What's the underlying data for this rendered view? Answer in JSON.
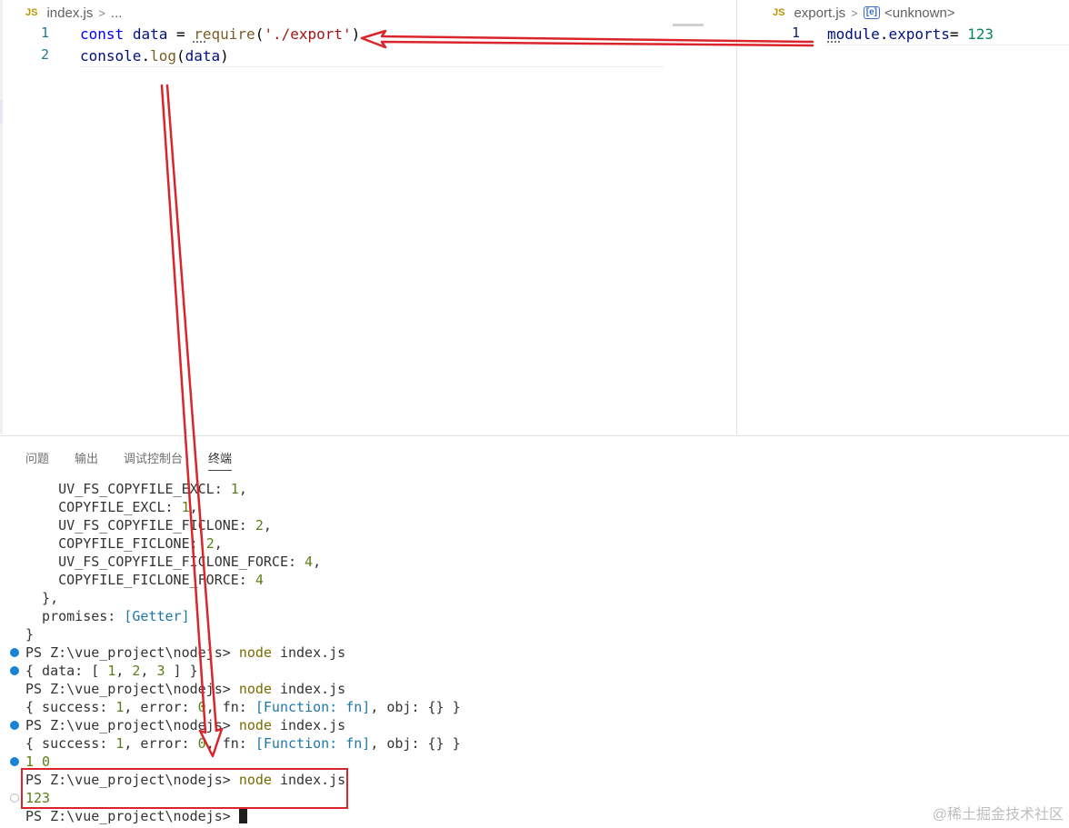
{
  "editor_left": {
    "breadcrumb": {
      "file_icon": "JS",
      "file": "index.js",
      "rest": "..."
    },
    "lines": [
      {
        "n": "1",
        "tokens": [
          {
            "t": "const",
            "c": "kw"
          },
          {
            "t": " ",
            "c": "plain"
          },
          {
            "t": "data",
            "c": "var"
          },
          {
            "t": " = ",
            "c": "plain"
          },
          {
            "t": "require",
            "c": "fn"
          },
          {
            "t": "(",
            "c": "plain"
          },
          {
            "t": "'./export'",
            "c": "str"
          },
          {
            "t": ")",
            "c": "plain"
          }
        ]
      },
      {
        "n": "2",
        "tokens": [
          {
            "t": "console",
            "c": "var"
          },
          {
            "t": ".",
            "c": "plain"
          },
          {
            "t": "log",
            "c": "fn"
          },
          {
            "t": "(",
            "c": "plain"
          },
          {
            "t": "data",
            "c": "var"
          },
          {
            "t": ")",
            "c": "plain"
          }
        ]
      }
    ]
  },
  "editor_right": {
    "breadcrumb": {
      "file_icon": "JS",
      "file": "export.js",
      "symbol_icon": "[e]",
      "symbol": "<unknown>"
    },
    "lines": [
      {
        "n": "1",
        "tokens": [
          {
            "t": "module",
            "c": "var"
          },
          {
            "t": ".",
            "c": "plain"
          },
          {
            "t": "exports",
            "c": "var"
          },
          {
            "t": "= ",
            "c": "plain"
          },
          {
            "t": "123",
            "c": "num"
          }
        ]
      }
    ]
  },
  "panel": {
    "tabs": [
      {
        "label": "问题",
        "active": false
      },
      {
        "label": "输出",
        "active": false
      },
      {
        "label": "调试控制台",
        "active": false
      },
      {
        "label": "终端",
        "active": true
      }
    ],
    "terminal_lines": [
      {
        "dot": "",
        "segs": [
          {
            "t": "    UV_FS_COPYFILE_EXCL: "
          },
          {
            "t": "1",
            "c": "t-num"
          },
          {
            "t": ","
          }
        ]
      },
      {
        "dot": "",
        "segs": [
          {
            "t": "    COPYFILE_EXCL: "
          },
          {
            "t": "1",
            "c": "t-num"
          },
          {
            "t": ","
          }
        ]
      },
      {
        "dot": "",
        "segs": [
          {
            "t": "    UV_FS_COPYFILE_FICLONE: "
          },
          {
            "t": "2",
            "c": "t-num"
          },
          {
            "t": ","
          }
        ]
      },
      {
        "dot": "",
        "segs": [
          {
            "t": "    COPYFILE_FICLONE: "
          },
          {
            "t": "2",
            "c": "t-num"
          },
          {
            "t": ","
          }
        ]
      },
      {
        "dot": "",
        "segs": [
          {
            "t": "    UV_FS_COPYFILE_FICLONE_FORCE: "
          },
          {
            "t": "4",
            "c": "t-num"
          },
          {
            "t": ","
          }
        ]
      },
      {
        "dot": "",
        "segs": [
          {
            "t": "    COPYFILE_FICLONE_FORCE: "
          },
          {
            "t": "4",
            "c": "t-num"
          }
        ]
      },
      {
        "dot": "",
        "segs": [
          {
            "t": "  },"
          }
        ]
      },
      {
        "dot": "",
        "segs": [
          {
            "t": "  promises: "
          },
          {
            "t": "[Getter]",
            "c": "t-cyan"
          }
        ]
      },
      {
        "dot": "",
        "segs": [
          {
            "t": "}"
          }
        ]
      },
      {
        "dot": "blue",
        "segs": [
          {
            "t": "PS Z:\\vue_project\\nodejs> "
          },
          {
            "t": "node",
            "c": "t-cmd"
          },
          {
            "t": " index.js"
          }
        ]
      },
      {
        "dot": "blue",
        "segs": [
          {
            "t": "{ data: [ "
          },
          {
            "t": "1",
            "c": "t-num"
          },
          {
            "t": ", "
          },
          {
            "t": "2",
            "c": "t-num"
          },
          {
            "t": ", "
          },
          {
            "t": "3",
            "c": "t-num"
          },
          {
            "t": " ] }"
          }
        ]
      },
      {
        "dot": "",
        "segs": [
          {
            "t": "PS Z:\\vue_project\\nodejs> "
          },
          {
            "t": "node",
            "c": "t-cmd"
          },
          {
            "t": " index.js"
          }
        ]
      },
      {
        "dot": "",
        "segs": [
          {
            "t": "{ success: "
          },
          {
            "t": "1",
            "c": "t-num"
          },
          {
            "t": ", error: "
          },
          {
            "t": "0",
            "c": "t-num"
          },
          {
            "t": ", fn: "
          },
          {
            "t": "[Function: fn]",
            "c": "t-cyan"
          },
          {
            "t": ", obj: {} }"
          }
        ]
      },
      {
        "dot": "blue",
        "segs": [
          {
            "t": "PS Z:\\vue_project\\nodejs> "
          },
          {
            "t": "node",
            "c": "t-cmd"
          },
          {
            "t": " index.js"
          }
        ]
      },
      {
        "dot": "",
        "segs": [
          {
            "t": "{ success: "
          },
          {
            "t": "1",
            "c": "t-num"
          },
          {
            "t": ", error: "
          },
          {
            "t": "0",
            "c": "t-num"
          },
          {
            "t": ", fn: "
          },
          {
            "t": "[Function: fn]",
            "c": "t-cyan"
          },
          {
            "t": ", obj: {} }"
          }
        ]
      },
      {
        "dot": "blue",
        "segs": [
          {
            "t": "1 0",
            "c": "t-num"
          }
        ]
      },
      {
        "dot": "",
        "segs": [
          {
            "t": "PS Z:\\vue_project\\nodejs> "
          },
          {
            "t": "node",
            "c": "t-cmd"
          },
          {
            "t": " index.js"
          }
        ]
      },
      {
        "dot": "hollow",
        "segs": [
          {
            "t": "123",
            "c": "t-num"
          }
        ]
      },
      {
        "dot": "",
        "segs": [
          {
            "t": "PS Z:\\vue_project\\nodejs> "
          }
        ],
        "cursor": true
      }
    ]
  },
  "annotation_color": "#d9252b",
  "watermark": "@稀土掘金技术社区"
}
